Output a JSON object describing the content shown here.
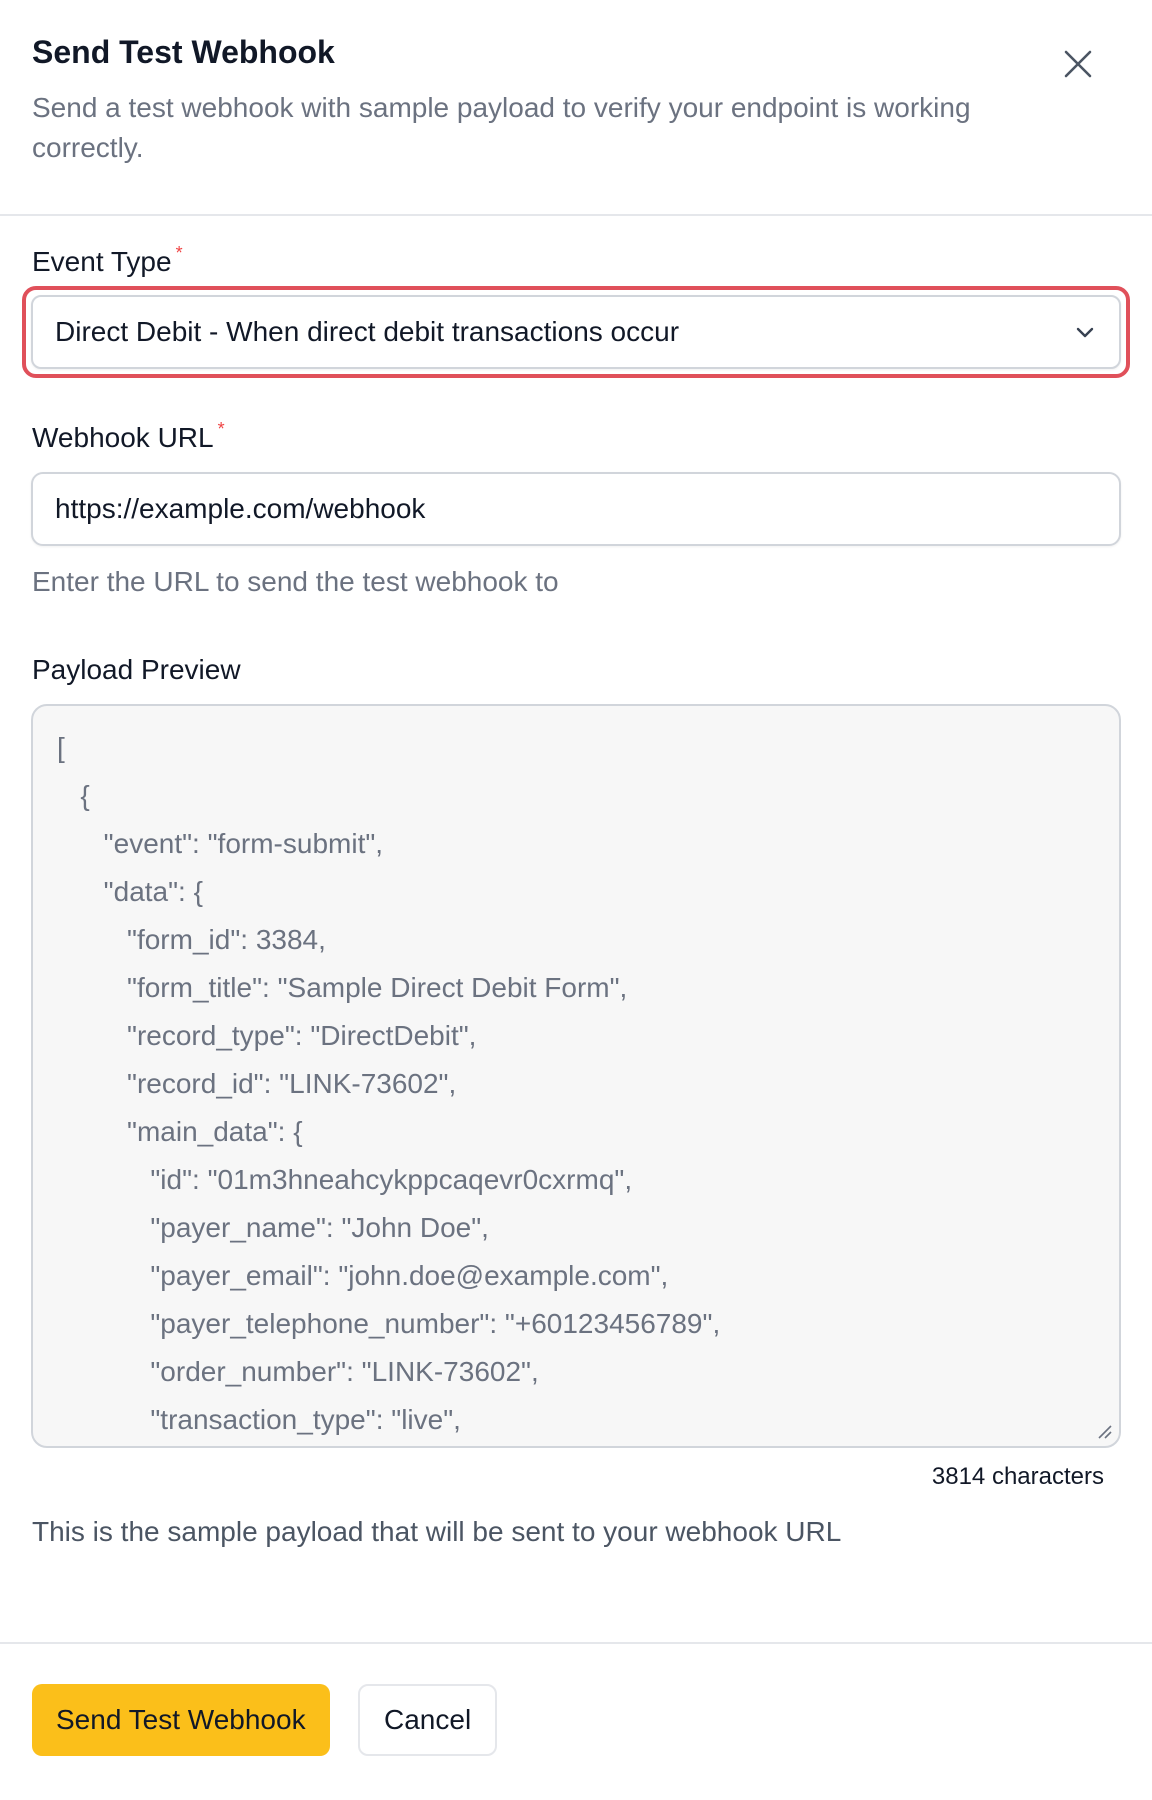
{
  "dialog": {
    "title": "Send Test Webhook",
    "description": "Send a test webhook with sample payload to verify your endpoint is working correctly."
  },
  "event_type": {
    "label": "Event Type",
    "required_mark": "*",
    "selected": "Direct Debit - When direct debit transactions occur"
  },
  "webhook_url": {
    "label": "Webhook URL",
    "required_mark": "*",
    "value": "https://example.com/webhook",
    "help": "Enter the URL to send the test webhook to"
  },
  "payload": {
    "label": "Payload Preview",
    "lines": [
      "[",
      "   {",
      "      \"event\": \"form-submit\",",
      "      \"data\": {",
      "         \"form_id\": 3384,",
      "         \"form_title\": \"Sample Direct Debit Form\",",
      "         \"record_type\": \"DirectDebit\",",
      "         \"record_id\": \"LINK-73602\",",
      "         \"main_data\": {",
      "            \"id\": \"01m3hneahcykppcaqevr0cxrmq\",",
      "            \"payer_name\": \"John Doe\",",
      "            \"payer_email\": \"john.doe@example.com\",",
      "            \"payer_telephone_number\": \"+60123456789\",",
      "            \"order_number\": \"LINK-73602\",",
      "            \"transaction_type\": \"live\","
    ],
    "char_count": "3814 characters",
    "help": "This is the sample payload that will be sent to your webhook URL"
  },
  "footer": {
    "primary_label": "Send Test Webhook",
    "secondary_label": "Cancel"
  },
  "colors": {
    "primary_button": "#fbbf1a",
    "focus_ring": "#e0505a",
    "required": "#ef4444"
  }
}
